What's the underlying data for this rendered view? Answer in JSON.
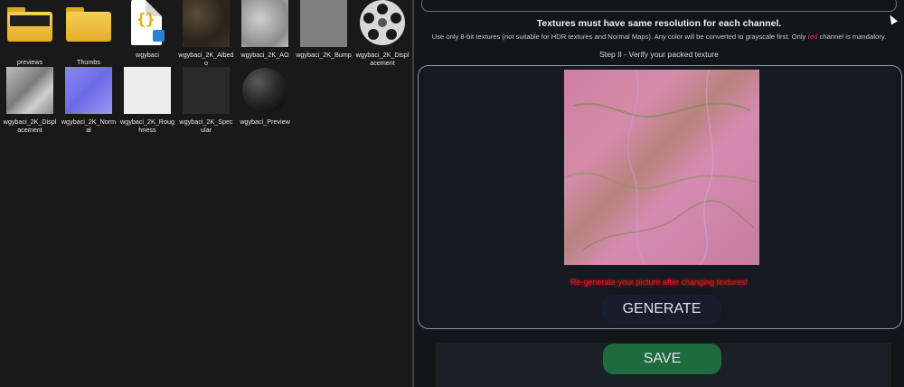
{
  "explorer": {
    "files": [
      {
        "name": "previews",
        "icon": "folder-icon"
      },
      {
        "name": "Thumbs",
        "icon": "folder-icon"
      },
      {
        "name": "wgybaci",
        "icon": "json-file-icon"
      },
      {
        "name": "wgybaci_2K_Albedo",
        "icon": "texture-thumbnail"
      },
      {
        "name": "wgybaci_2K_AO",
        "icon": "texture-thumbnail"
      },
      {
        "name": "wgybaci_2K_Bump",
        "icon": "texture-thumbnail"
      },
      {
        "name": "wgybaci_2K_Displacement",
        "icon": "video-reel-icon"
      },
      {
        "name": "wgybaci_2K_Displacement",
        "icon": "texture-thumbnail"
      },
      {
        "name": "wgybaci_2K_Normal",
        "icon": "texture-thumbnail"
      },
      {
        "name": "wgybaci_2K_Roughness",
        "icon": "texture-thumbnail"
      },
      {
        "name": "wgybaci_2K_Specular",
        "icon": "texture-thumbnail"
      },
      {
        "name": "wgybaci_Preview",
        "icon": "sphere-thumbnail"
      }
    ]
  },
  "packer": {
    "heading": "Textures must have same resolution for each channel.",
    "note_prefix": "Use only 8-bit textures (not suitable for HDR textures and Normal Maps). Any color will be converted to grayscale first. Only",
    "note_red": "red",
    "note_suffix": "channel is mandatory.",
    "step_label": "Step II - Verify your packed texture",
    "warning": "Re-generate your picture after changing textures!",
    "generate_label": "GENERATE",
    "save_label": "SAVE"
  },
  "colors": {
    "accent_red": "#e01515",
    "save_green": "#1e6b3e"
  }
}
